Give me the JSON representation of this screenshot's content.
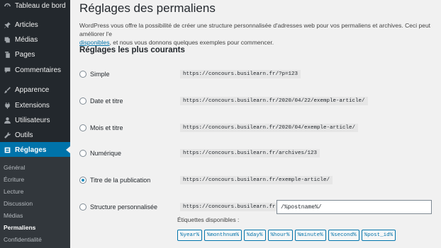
{
  "sidebar": {
    "items": [
      {
        "label": "Tableau de bord",
        "icon": "dashboard-icon"
      },
      {
        "label": "Articles",
        "icon": "pin-icon"
      },
      {
        "label": "Médias",
        "icon": "media-icon"
      },
      {
        "label": "Pages",
        "icon": "page-icon"
      },
      {
        "label": "Commentaires",
        "icon": "comment-icon"
      },
      {
        "label": "Apparence",
        "icon": "brush-icon"
      },
      {
        "label": "Extensions",
        "icon": "plugin-icon"
      },
      {
        "label": "Utilisateurs",
        "icon": "user-icon"
      },
      {
        "label": "Outils",
        "icon": "wrench-icon"
      },
      {
        "label": "Réglages",
        "icon": "settings-icon"
      }
    ],
    "submenu": [
      "Général",
      "Écriture",
      "Lecture",
      "Discussion",
      "Médias",
      "Permaliens",
      "Confidentialité"
    ]
  },
  "main": {
    "title": "Réglages des permaliens",
    "intro_part1": "WordPress vous offre la possibilité de créer une structure personnalisée d'adresses web pour vos permaliens et archives. Ceci peut améliorer l'e",
    "intro_link": "disponibles",
    "intro_part2": ", et nous vous donnons quelques exemples pour commencer.",
    "section_title": "Réglages les plus courants",
    "options": [
      {
        "label": "Simple",
        "url": "https://concours.busilearn.fr/?p=123",
        "checked": false
      },
      {
        "label": "Date et titre",
        "url": "https://concours.busilearn.fr/2020/04/22/exemple-article/",
        "checked": false
      },
      {
        "label": "Mois et titre",
        "url": "https://concours.busilearn.fr/2020/04/exemple-article/",
        "checked": false
      },
      {
        "label": "Numérique",
        "url": "https://concours.busilearn.fr/archives/123",
        "checked": false
      },
      {
        "label": "Titre de la publication",
        "url": "https://concours.busilearn.fr/exemple-article/",
        "checked": true
      },
      {
        "label": "Structure personnalisée",
        "url": "https://concours.busilearn.fr",
        "checked": false
      }
    ],
    "custom_value": "/%postname%/",
    "tags_label": "Étiquettes disponibles :",
    "tags": [
      "%year%",
      "%monthnum%",
      "%day%",
      "%hour%",
      "%minute%",
      "%second%",
      "%post_id%"
    ]
  },
  "colors": {
    "sidebar_bg": "#23282d",
    "accent": "#0073aa",
    "background": "#f1f1f1"
  }
}
